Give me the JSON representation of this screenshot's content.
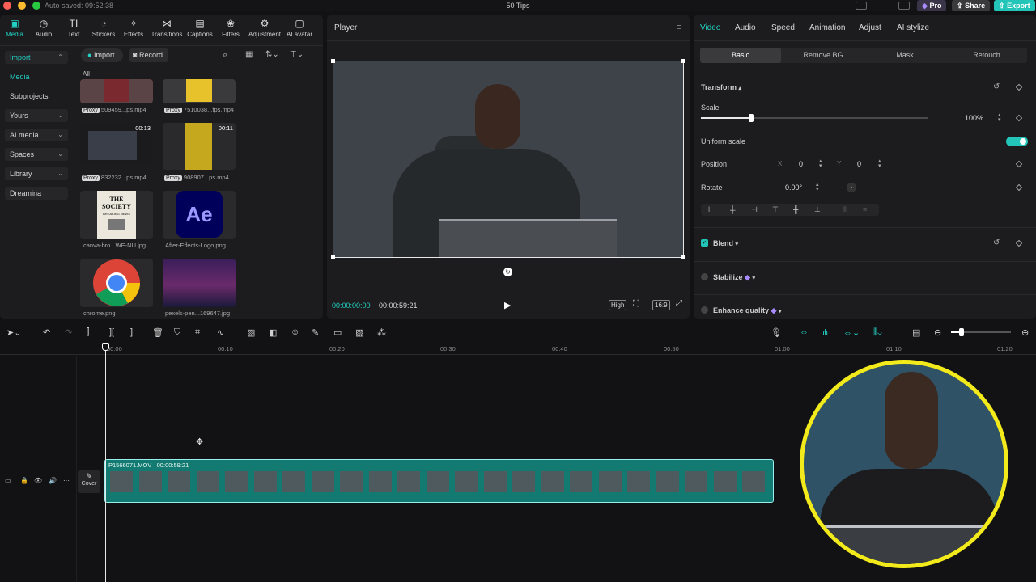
{
  "titlebar": {
    "autosave": "Auto saved: 09:52:38",
    "title": "50 Tips",
    "pro_label": "Pro",
    "share_label": "Share",
    "export_label": "Export"
  },
  "toolbar": {
    "tabs": [
      {
        "label": "Media",
        "icon": "media-icon"
      },
      {
        "label": "Audio",
        "icon": "audio-icon"
      },
      {
        "label": "Text",
        "icon": "text-icon"
      },
      {
        "label": "Stickers",
        "icon": "stickers-icon"
      },
      {
        "label": "Effects",
        "icon": "effects-icon"
      },
      {
        "label": "Transitions",
        "icon": "transitions-icon"
      },
      {
        "label": "Captions",
        "icon": "captions-icon"
      },
      {
        "label": "Filters",
        "icon": "filters-icon"
      },
      {
        "label": "Adjustment",
        "icon": "adjustment-icon"
      },
      {
        "label": "AI avatar",
        "icon": "ai-avatar-icon"
      }
    ]
  },
  "sidebar": {
    "items": [
      {
        "label": "Import"
      },
      {
        "label": "Media"
      },
      {
        "label": "Subprojects"
      },
      {
        "label": "Yours"
      },
      {
        "label": "AI media"
      },
      {
        "label": "Spaces"
      },
      {
        "label": "Library"
      },
      {
        "label": "Dreamina"
      }
    ]
  },
  "media": {
    "import_label": "Import",
    "record_label": "Record",
    "filter_all": "All",
    "items": [
      {
        "name": "509459...ps.mp4",
        "proxy": "Proxy",
        "duration": ""
      },
      {
        "name": "7510038...fps.mp4",
        "proxy": "Proxy",
        "duration": ""
      },
      {
        "name": "832232...ps.mp4",
        "proxy": "Proxy",
        "duration": "00:13"
      },
      {
        "name": "908907...ps.mp4",
        "proxy": "Proxy",
        "duration": "00:11"
      },
      {
        "name": "canva-bro...WE-NU.jpg",
        "proxy": "",
        "duration": "",
        "thumb_text": "THE SOCIETY",
        "thumb_sub": "BREAKING NEWS"
      },
      {
        "name": "After-Effects-Logo.png",
        "proxy": "",
        "duration": "",
        "thumb_text": "Ae"
      },
      {
        "name": "chrome.png",
        "proxy": "",
        "duration": ""
      },
      {
        "name": "pexels-pen...169647.jpg",
        "proxy": "",
        "duration": ""
      }
    ]
  },
  "player": {
    "title": "Player",
    "current_time": "00:00:00:00",
    "total_time": "00:00:59:21",
    "quality": "High",
    "ratio": "16:9"
  },
  "props": {
    "tabs": [
      "Video",
      "Audio",
      "Speed",
      "Animation",
      "Adjust",
      "AI stylize"
    ],
    "subtabs": [
      "Basic",
      "Remove BG",
      "Mask",
      "Retouch"
    ],
    "transform_label": "Transform",
    "scale_label": "Scale",
    "scale_value": "100%",
    "scale_fraction": 0.22,
    "uniform_label": "Uniform scale",
    "position_label": "Position",
    "pos_x_label": "X",
    "pos_x": "0",
    "pos_y_label": "Y",
    "pos_y": "0",
    "rotate_label": "Rotate",
    "rotate_value": "0.00°",
    "blend_label": "Blend",
    "stabilize_label": "Stabilize",
    "enhance_label": "Enhance quality"
  },
  "timeline": {
    "ticks": [
      "00:00",
      "00:10",
      "00:20",
      "00:30",
      "00:40",
      "00:50",
      "01:00",
      "01:10",
      "01:20"
    ],
    "clip_name": "P1566071.MOV",
    "clip_duration": "00:00:59:21",
    "cover_label": "Cover"
  },
  "colors": {
    "accent": "#22d3c5",
    "clip": "#137a72",
    "webcam_ring": "#f2ea1a"
  }
}
